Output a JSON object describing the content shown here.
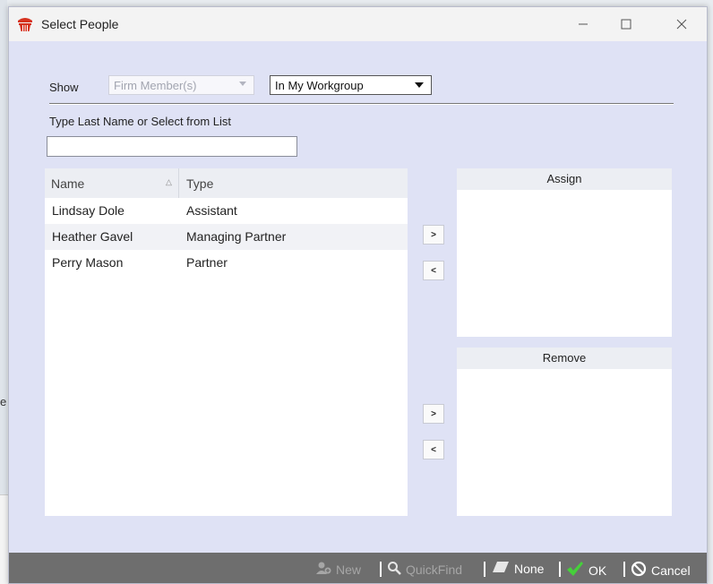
{
  "window": {
    "title": "Select People"
  },
  "filters": {
    "show_label": "Show",
    "member_type": "Firm Member(s)",
    "workgroup": "In My Workgroup"
  },
  "search": {
    "label": "Type Last Name or Select from List",
    "value": "",
    "placeholder": ""
  },
  "people_list": {
    "columns": [
      "Name",
      "Type"
    ],
    "rows": [
      {
        "name": "Lindsay Dole",
        "type": "Assistant"
      },
      {
        "name": "Heather Gavel",
        "type": "Managing Partner"
      },
      {
        "name": "Perry Mason",
        "type": "Partner"
      }
    ]
  },
  "transfer": {
    "add_label": ">",
    "remove_label": "<"
  },
  "assign_panel": {
    "title": "Assign"
  },
  "remove_panel": {
    "title": "Remove"
  },
  "footer": {
    "new_label": "New",
    "quickfind_label": "QuickFind",
    "none_label": "None",
    "ok_label": "OK",
    "cancel_label": "Cancel"
  },
  "background": {
    "edge_glyph": "e"
  },
  "colors": {
    "dialog_bg": "#dfe2f5",
    "footer_bg": "#6e6e6e",
    "ok_check": "#45d03a",
    "app_icon": "#d6321f"
  },
  "icons": [
    "app-icon",
    "minimize-icon",
    "maximize-icon",
    "close-icon",
    "sort-asc-icon",
    "new-person-icon",
    "quickfind-icon",
    "eraser-icon",
    "checkmark-icon",
    "cancel-icon"
  ]
}
